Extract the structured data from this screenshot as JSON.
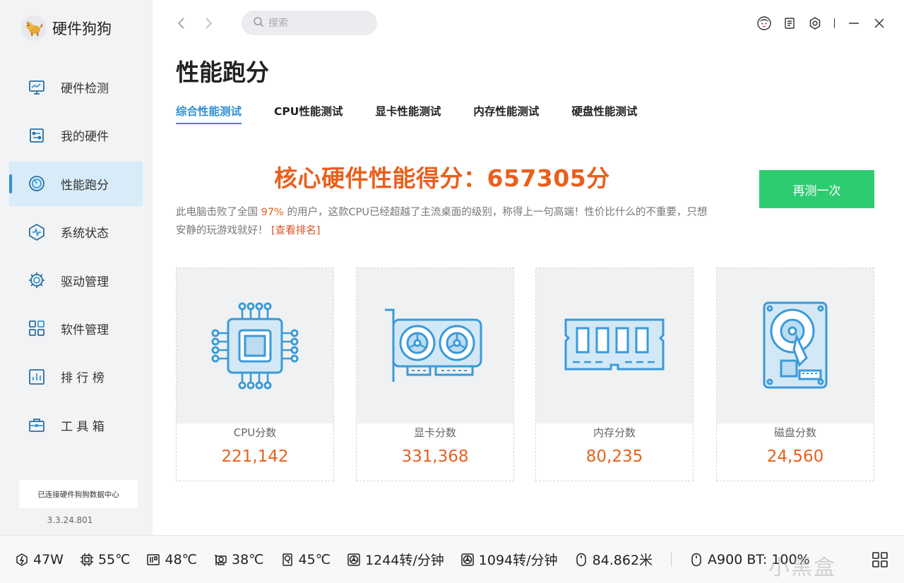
{
  "app": {
    "title": "硬件狗狗",
    "version": "3.3.24.801",
    "connection_status": "已连接硬件狗狗数据中心"
  },
  "search": {
    "placeholder": "搜索"
  },
  "sidebar": {
    "items": [
      {
        "label": "硬件检测",
        "icon": "monitor-icon",
        "active": false
      },
      {
        "label": "我的硬件",
        "icon": "hardware-chip-icon",
        "active": false
      },
      {
        "label": "性能跑分",
        "icon": "speedometer-icon",
        "active": true
      },
      {
        "label": "系统状态",
        "icon": "system-status-icon",
        "active": false
      },
      {
        "label": "驱动管理",
        "icon": "gear-icon",
        "active": false
      },
      {
        "label": "软件管理",
        "icon": "apps-grid-icon",
        "active": false
      },
      {
        "label": "排 行 榜",
        "icon": "ranking-icon",
        "active": false
      },
      {
        "label": "工 具 箱",
        "icon": "toolbox-icon",
        "active": false
      }
    ]
  },
  "main": {
    "title": "性能跑分",
    "tabs": [
      {
        "label": "综合性能测试",
        "active": true
      },
      {
        "label": "CPU性能测试",
        "active": false
      },
      {
        "label": "显卡性能测试",
        "active": false
      },
      {
        "label": "内存性能测试",
        "active": false
      },
      {
        "label": "硬盘性能测试",
        "active": false
      }
    ],
    "headline": "核心硬件性能得分：657305分",
    "retest_label": "再测一次",
    "desc_part1": "此电脑击败了全国 ",
    "desc_percent": "97%",
    "desc_part2": " 的用户，这款CPU已经超越了主流桌面的级别，称得上一句高端！性价比什么的不重要，只想安静的玩游戏就好！ ",
    "desc_link": "[查看排名]",
    "cards": [
      {
        "label": "CPU分数",
        "value": "221,142",
        "icon": "cpu-icon"
      },
      {
        "label": "显卡分数",
        "value": "331,368",
        "icon": "graphics-card-icon"
      },
      {
        "label": "内存分数",
        "value": "80,235",
        "icon": "memory-icon"
      },
      {
        "label": "磁盘分数",
        "value": "24,560",
        "icon": "hard-disk-icon"
      }
    ]
  },
  "statusbar": {
    "items": [
      {
        "icon": "power-icon",
        "value": "47W"
      },
      {
        "icon": "cpu-temp-icon",
        "value": "55℃"
      },
      {
        "icon": "board-temp-icon",
        "value": "48℃"
      },
      {
        "icon": "gpu-temp-icon",
        "value": "38℃"
      },
      {
        "icon": "disk-temp-icon",
        "value": "45℃"
      },
      {
        "icon": "fan-icon",
        "value": "1244转/分钟"
      },
      {
        "icon": "fan-icon",
        "value": "1094转/分钟"
      },
      {
        "icon": "mouse-icon",
        "value": "84.862米"
      },
      {
        "icon": "mouse-battery-icon",
        "value": "A900 BT: 100%"
      }
    ],
    "watermark": "小黑盒"
  },
  "colors": {
    "accent": "#2d8fd6",
    "score": "#e8601c",
    "retest": "#2ecc71",
    "icon_blue": "#3a9ad9"
  }
}
